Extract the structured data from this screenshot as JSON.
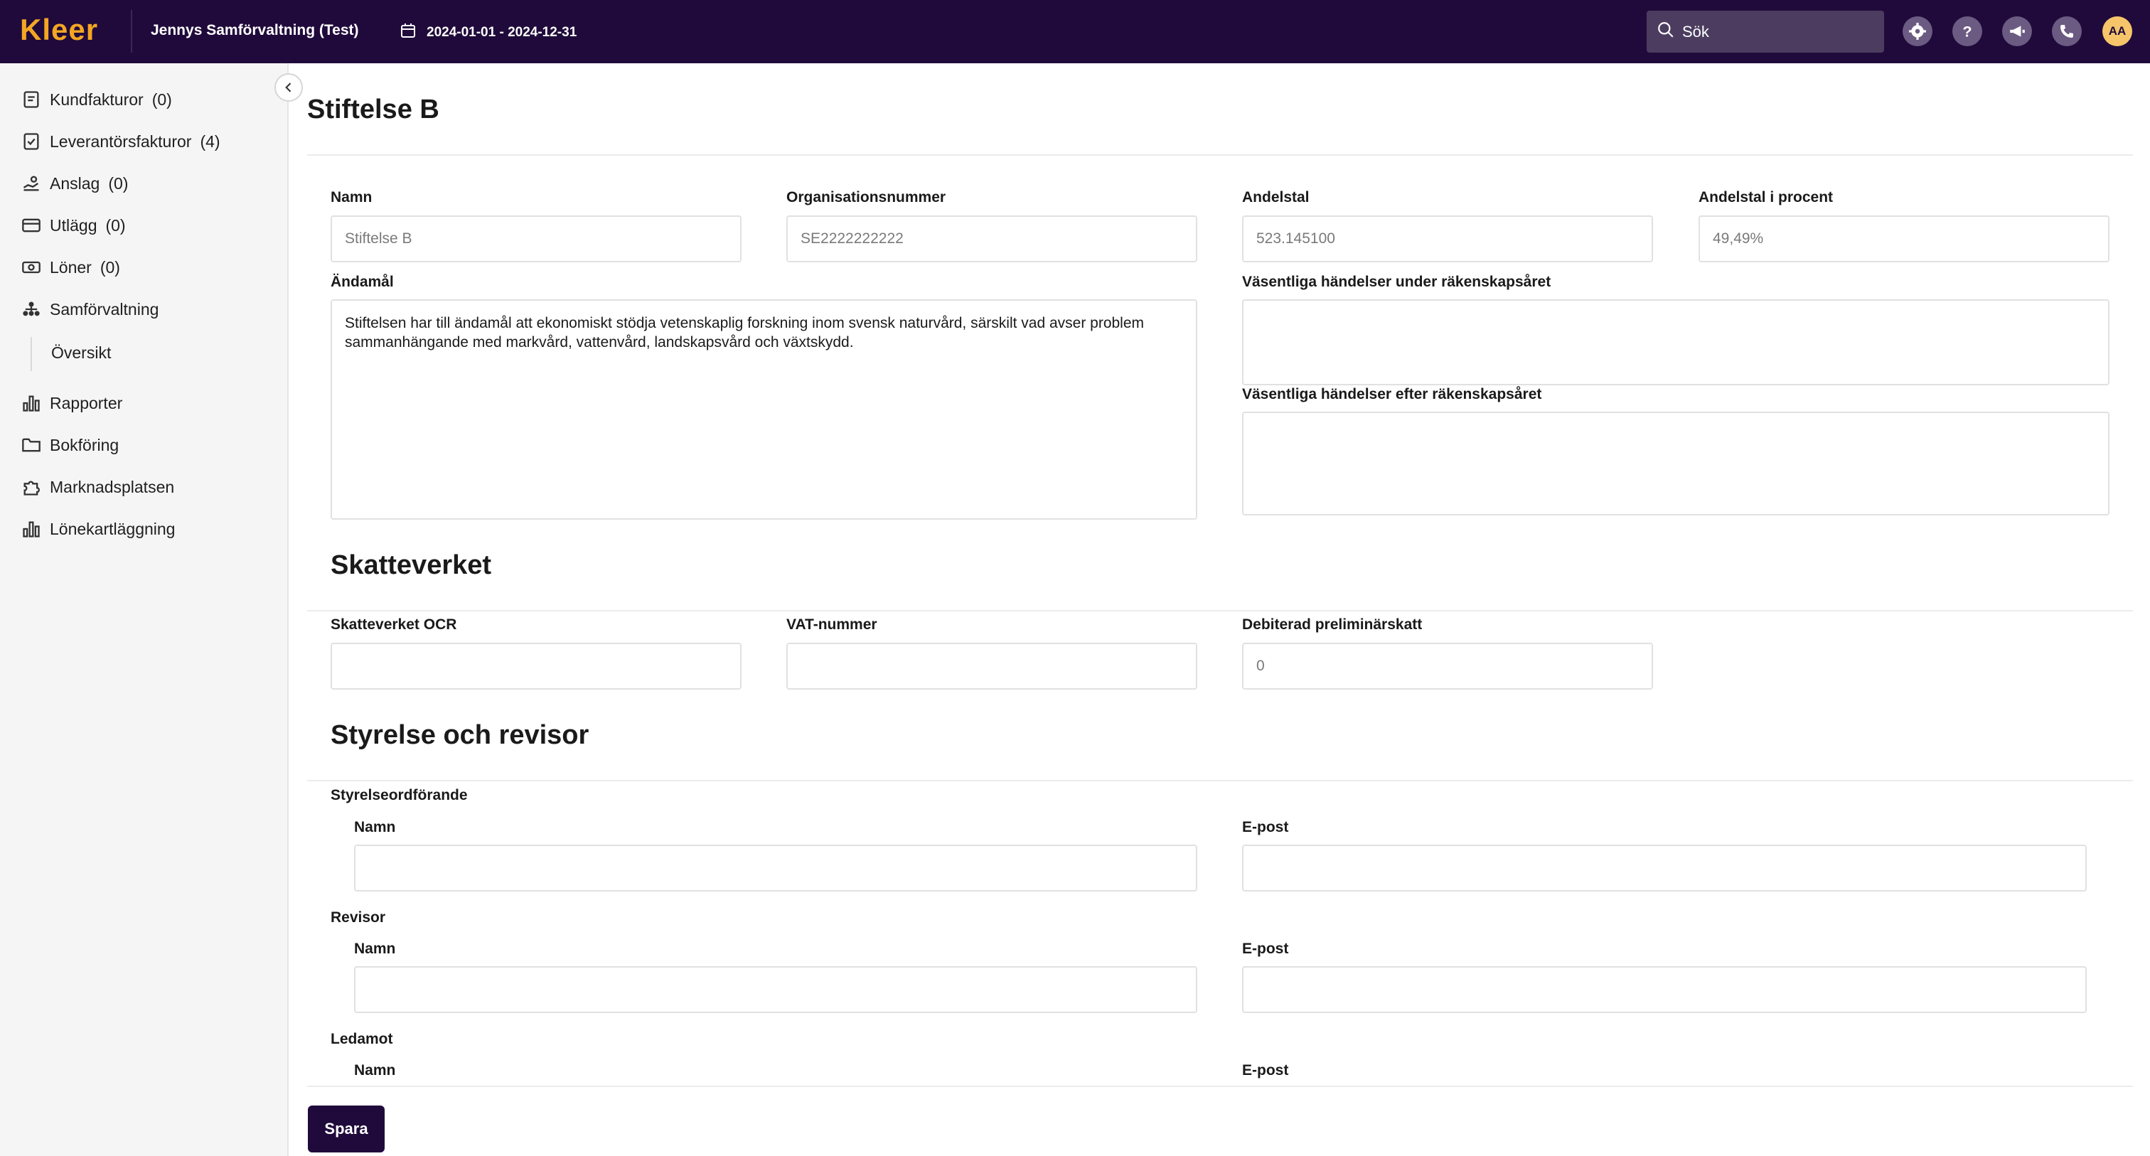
{
  "header": {
    "logo": "Kleer",
    "company": "Jennys Samförvaltning (Test)",
    "period": "2024-01-01 - 2024-12-31",
    "search_placeholder": "Sök",
    "avatar": "AA"
  },
  "sidebar": {
    "items": [
      {
        "label": "Kundfakturor",
        "count": "(0)",
        "icon": "invoice-icon"
      },
      {
        "label": "Leverantörsfakturor",
        "count": "(4)",
        "icon": "supplier-invoice-icon"
      },
      {
        "label": "Anslag",
        "count": "(0)",
        "icon": "grant-icon"
      },
      {
        "label": "Utlägg",
        "count": "(0)",
        "icon": "card-icon"
      },
      {
        "label": "Löner",
        "count": "(0)",
        "icon": "money-icon"
      },
      {
        "label": "Samförvaltning",
        "count": "",
        "icon": "org-chart-icon"
      },
      {
        "label": "Översikt",
        "count": "",
        "icon": ""
      },
      {
        "label": "Rapporter",
        "count": "",
        "icon": "bar-chart-icon"
      },
      {
        "label": "Bokföring",
        "count": "",
        "icon": "folder-icon"
      },
      {
        "label": "Marknadsplatsen",
        "count": "",
        "icon": "puzzle-icon"
      },
      {
        "label": "Lönekartläggning",
        "count": "",
        "icon": "bar-chart-icon"
      }
    ]
  },
  "main": {
    "title": "Stiftelse B",
    "fields": {
      "namn_label": "Namn",
      "namn_value": "Stiftelse B",
      "orgnr_label": "Organisationsnummer",
      "orgnr_value": "SE2222222222",
      "andelstal_label": "Andelstal",
      "andelstal_value": "523.145100",
      "andelstal_procent_label": "Andelstal i procent",
      "andelstal_procent_value": "49,49%",
      "andamal_label": "Ändamål",
      "andamal_value": "Stiftelsen har till ändamål att ekonomiskt stödja vetenskaplig forskning inom svensk naturvård, särskilt vad avser problem sammanhängande med markvård, vattenvård, landskapsvård och växtskydd.",
      "handelser_under_label": "Väsentliga händelser under räkenskapsåret",
      "handelser_under_value": "",
      "handelser_efter_label": "Väsentliga händelser efter räkenskapsåret",
      "handelser_efter_value": ""
    },
    "skatteverket": {
      "title": "Skatteverket",
      "ocr_label": "Skatteverket OCR",
      "ocr_value": "",
      "vat_label": "VAT-nummer",
      "vat_value": "",
      "prelskatt_label": "Debiterad preliminärskatt",
      "prelskatt_placeholder": "0"
    },
    "styrelse": {
      "title": "Styrelse och revisor",
      "groups": [
        {
          "heading": "Styrelseordförande",
          "name_label": "Namn",
          "email_label": "E-post",
          "name_value": "",
          "email_value": ""
        },
        {
          "heading": "Revisor",
          "name_label": "Namn",
          "email_label": "E-post",
          "name_value": "",
          "email_value": ""
        },
        {
          "heading": "Ledamot",
          "name_label": "Namn",
          "email_label": "E-post"
        }
      ]
    },
    "save_label": "Spara"
  }
}
